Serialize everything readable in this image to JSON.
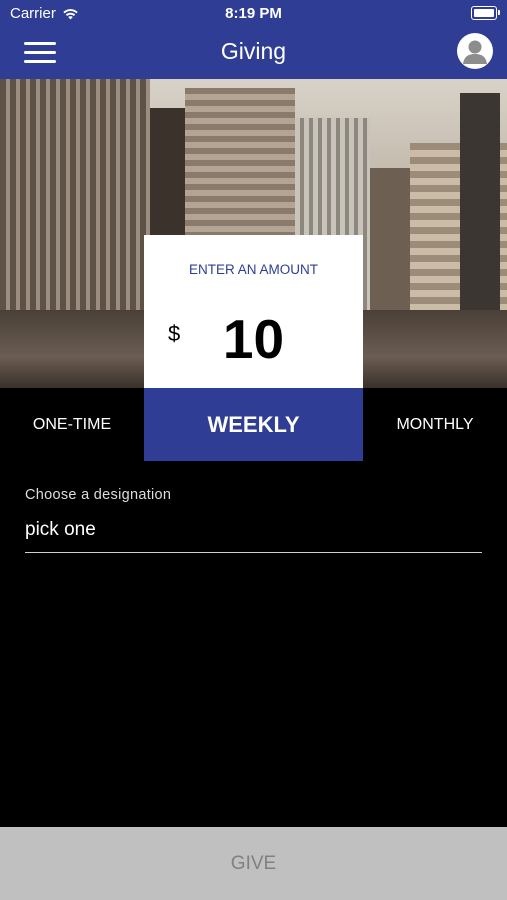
{
  "status_bar": {
    "carrier": "Carrier",
    "time": "8:19 PM",
    "wifi_icon": "wifi-icon",
    "battery_icon": "battery-icon"
  },
  "nav": {
    "title": "Giving",
    "menu_icon": "hamburger-menu-icon",
    "profile_icon": "user-avatar-icon"
  },
  "amount": {
    "label": "ENTER AN AMOUNT",
    "currency": "$",
    "value": "10"
  },
  "frequency": {
    "options": [
      "ONE-TIME",
      "WEEKLY",
      "MONTHLY"
    ],
    "selected": "WEEKLY"
  },
  "designation": {
    "label": "Choose a designation",
    "value": "pick one"
  },
  "give_button": {
    "label": "GIVE"
  },
  "colors": {
    "brand": "#2f3e94",
    "background": "#000000",
    "button_disabled": "#c0c0c0"
  }
}
